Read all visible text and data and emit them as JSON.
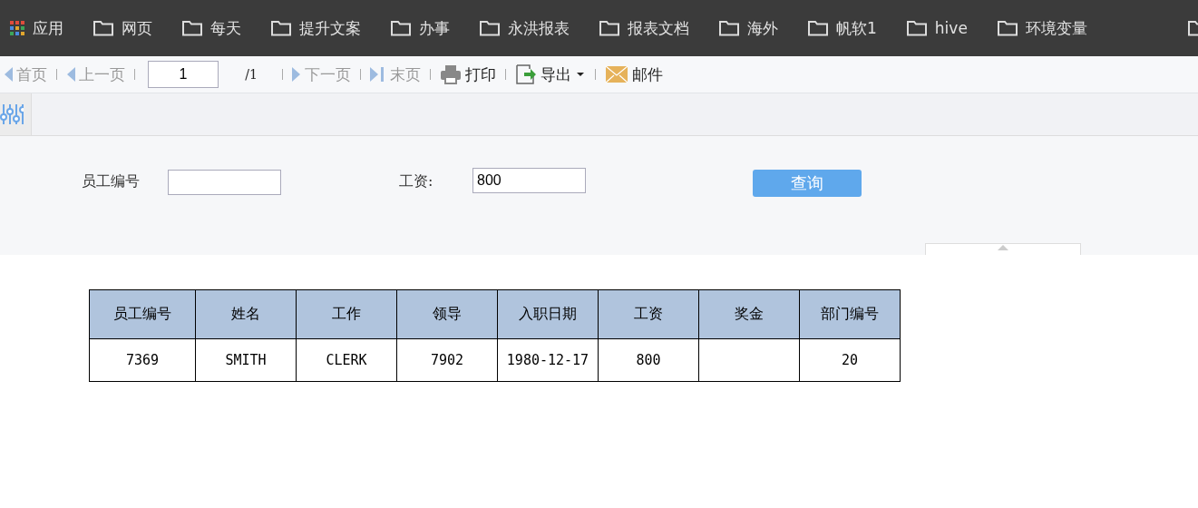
{
  "bookmarks": [
    {
      "kind": "apps",
      "label": "应用"
    },
    {
      "kind": "folder",
      "label": "网页"
    },
    {
      "kind": "folder",
      "label": "每天"
    },
    {
      "kind": "folder",
      "label": "提升文案"
    },
    {
      "kind": "folder",
      "label": "办事"
    },
    {
      "kind": "folder",
      "label": "永洪报表"
    },
    {
      "kind": "folder",
      "label": "报表文档"
    },
    {
      "kind": "folder",
      "label": "海外"
    },
    {
      "kind": "folder",
      "label": "帆软1"
    },
    {
      "kind": "folder",
      "label": "hive"
    },
    {
      "kind": "folder",
      "label": "环境变量"
    }
  ],
  "toolbar": {
    "first": {
      "label": "首页",
      "disabled": true
    },
    "prev": {
      "label": "上一页",
      "disabled": true
    },
    "page": "1",
    "total": "/1",
    "next": {
      "label": "下一页",
      "disabled": true
    },
    "last": {
      "label": "末页",
      "disabled": true
    },
    "print": "打印",
    "export": "导出",
    "mail": "邮件"
  },
  "form": {
    "fields": [
      {
        "label": "员工编号"
      },
      {
        "label": "工资:",
        "value": "800"
      }
    ],
    "button": "查询"
  },
  "table": {
    "columns": [
      "员工编号",
      "姓名",
      "工作",
      "领导",
      "入职日期",
      "工资",
      "奖金",
      "部门编号"
    ],
    "rows": [
      [
        "7369",
        "SMITH",
        "CLERK",
        "7902",
        "1980-12-17",
        "800",
        null,
        "20"
      ]
    ]
  }
}
